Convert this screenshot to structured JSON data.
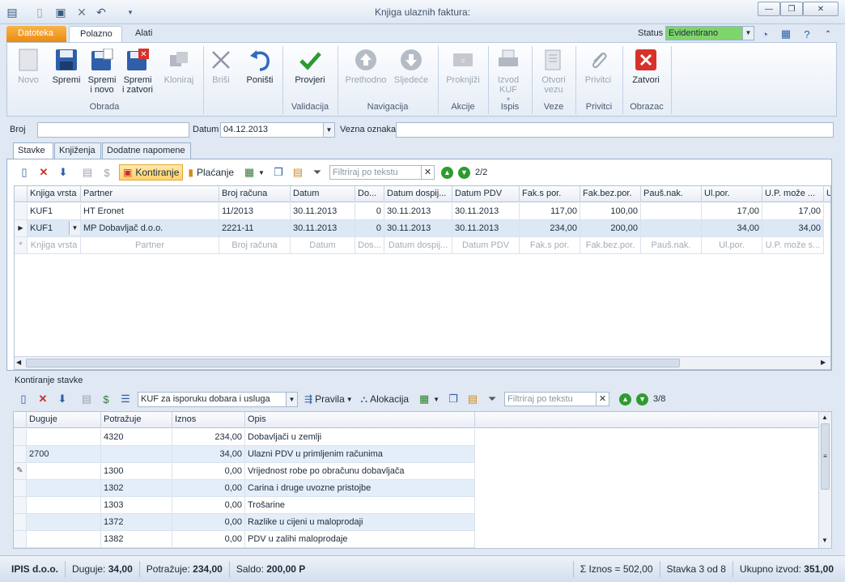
{
  "window": {
    "title": "Knjiga ulaznih faktura:"
  },
  "ribbon": {
    "tabs": [
      "Datoteka",
      "Polazno",
      "Alati"
    ],
    "status_label": "Status",
    "status_value": "Evidentirano",
    "buttons": {
      "novo": "Novo",
      "spremi": "Spremi",
      "spremi_novo": "Spremi i novo",
      "spremi_zatvori": "Spremi i zatvori",
      "kloniraj": "Kloniraj",
      "brisi": "Briši",
      "ponisti": "Poništi",
      "provjeri": "Provjeri",
      "prethodno": "Prethodno",
      "sljedece": "Sljedeće",
      "proknjizi": "Proknjiži",
      "izvod": "Izvod KUF",
      "otvori": "Otvori vezu",
      "privitci": "Privitci",
      "zatvori": "Zatvori"
    },
    "groups": {
      "obrada": "Obrada",
      "validacija": "Validacija",
      "navigacija": "Navigacija",
      "akcije": "Akcije",
      "ispis": "Ispis",
      "veze": "Veze",
      "privitci": "Privitci",
      "obrazac": "Obrazac"
    }
  },
  "header": {
    "broj_label": "Broj",
    "broj_value": "",
    "datum_label": "Datum",
    "datum_value": "04.12.2013",
    "vezna_label": "Vezna oznaka",
    "vezna_value": ""
  },
  "doc_tabs": [
    "Stavke",
    "Knjiženja",
    "Dodatne napomene"
  ],
  "stavke": {
    "toolbar": {
      "kontiranje": "Kontiranje",
      "placanje": "Plaćanje",
      "filter_placeholder": "Filtriraj po tekstu",
      "counter": "2/2"
    },
    "columns": [
      "Knjiga vrsta",
      "Partner",
      "Broj računa",
      "Datum",
      "Do...",
      "Datum dospij...",
      "Datum PDV",
      "Fak.s por.",
      "Fak.bez.por.",
      "Pauš.nak.",
      "Ul.por.",
      "U.P. može ...",
      "U"
    ],
    "rows": [
      [
        "KUF1",
        "HT Eronet",
        "11/2013",
        "30.11.2013",
        "0",
        "30.11.2013",
        "30.11.2013",
        "117,00",
        "100,00",
        "",
        "17,00",
        "17,00"
      ],
      [
        "KUF1",
        "MP Dobavljač d.o.o.",
        "2221-11",
        "30.11.2013",
        "0",
        "30.11.2013",
        "30.11.2013",
        "234,00",
        "200,00",
        "",
        "34,00",
        "34,00"
      ]
    ],
    "new_row": [
      "Knjiga vrsta",
      "Partner",
      "Broj računa",
      "Datum",
      "Dos...",
      "Datum dospij...",
      "Datum PDV",
      "Fak.s por.",
      "Fak.bez.por.",
      "Pauš.nak.",
      "Ul.por.",
      "U.P. može s..."
    ]
  },
  "kontiranje": {
    "title": "Kontiranje stavke",
    "toolbar": {
      "combo": "KUF za isporuku dobara i usluga",
      "pravila": "Pravila",
      "alokacija": "Alokacija",
      "filter_placeholder": "Filtriraj po tekstu",
      "counter": "3/8"
    },
    "columns": [
      "Duguje",
      "Potražuje",
      "Iznos",
      "Opis"
    ],
    "rows": [
      [
        "",
        "4320",
        "234,00",
        "Dobavljači u zemlji"
      ],
      [
        "2700",
        "",
        "34,00",
        "Ulazni PDV u primljenim računima"
      ],
      [
        "",
        "1300",
        "0,00",
        "Vrijednost robe po obračunu dobavljača"
      ],
      [
        "",
        "1302",
        "0,00",
        "Carina i druge uvozne pristojbe"
      ],
      [
        "",
        "1303",
        "0,00",
        "Trošarine"
      ],
      [
        "",
        "1372",
        "0,00",
        "Razlike u cijeni u maloprodaji"
      ],
      [
        "",
        "1382",
        "0,00",
        "PDV u zalihi maloprodaje"
      ]
    ]
  },
  "statusbar": {
    "company": "IPIS d.o.o.",
    "duguje_label": "Duguje:",
    "duguje": "34,00",
    "potrazuje_label": "Potražuje:",
    "potrazuje": "234,00",
    "saldo_label": "Saldo:",
    "saldo": "200,00 P",
    "iznos": "Σ Iznos = 502,00",
    "stavka": "Stavka 3 od 8",
    "ukupno_label": "Ukupno izvod:",
    "ukupno": "351,00"
  }
}
